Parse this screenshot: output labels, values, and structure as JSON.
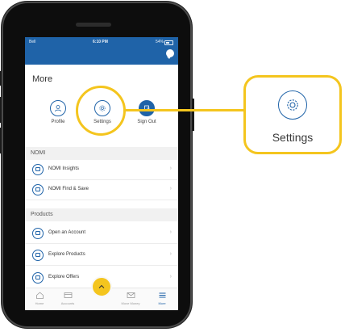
{
  "status_bar": {
    "carrier": "Bell",
    "time": "6:10 PM",
    "battery": "54%"
  },
  "page": {
    "title": "More"
  },
  "quick_actions": {
    "profile": "Profile",
    "settings": "Settings",
    "sign_out": "Sign Out"
  },
  "sections": {
    "nomi": {
      "heading": "NOMI",
      "items": [
        {
          "label": "NOMI Insights",
          "icon": "insights-icon"
        },
        {
          "label": "NOMI Find & Save",
          "icon": "find-save-icon"
        }
      ]
    },
    "products": {
      "heading": "Products",
      "items": [
        {
          "label": "Open an Account",
          "icon": "open-account-icon"
        },
        {
          "label": "Explore Products",
          "icon": "explore-products-icon"
        },
        {
          "label": "Explore Offers",
          "icon": "explore-offers-icon"
        }
      ]
    }
  },
  "bottom_nav": {
    "home": "Home",
    "accounts": "Accounts",
    "move_money": "Move Money",
    "more": "More"
  },
  "callout": {
    "label": "Settings",
    "icon": "gear-icon"
  },
  "colors": {
    "brand_blue": "#1f63a8",
    "highlight_yellow": "#f4c51e"
  }
}
